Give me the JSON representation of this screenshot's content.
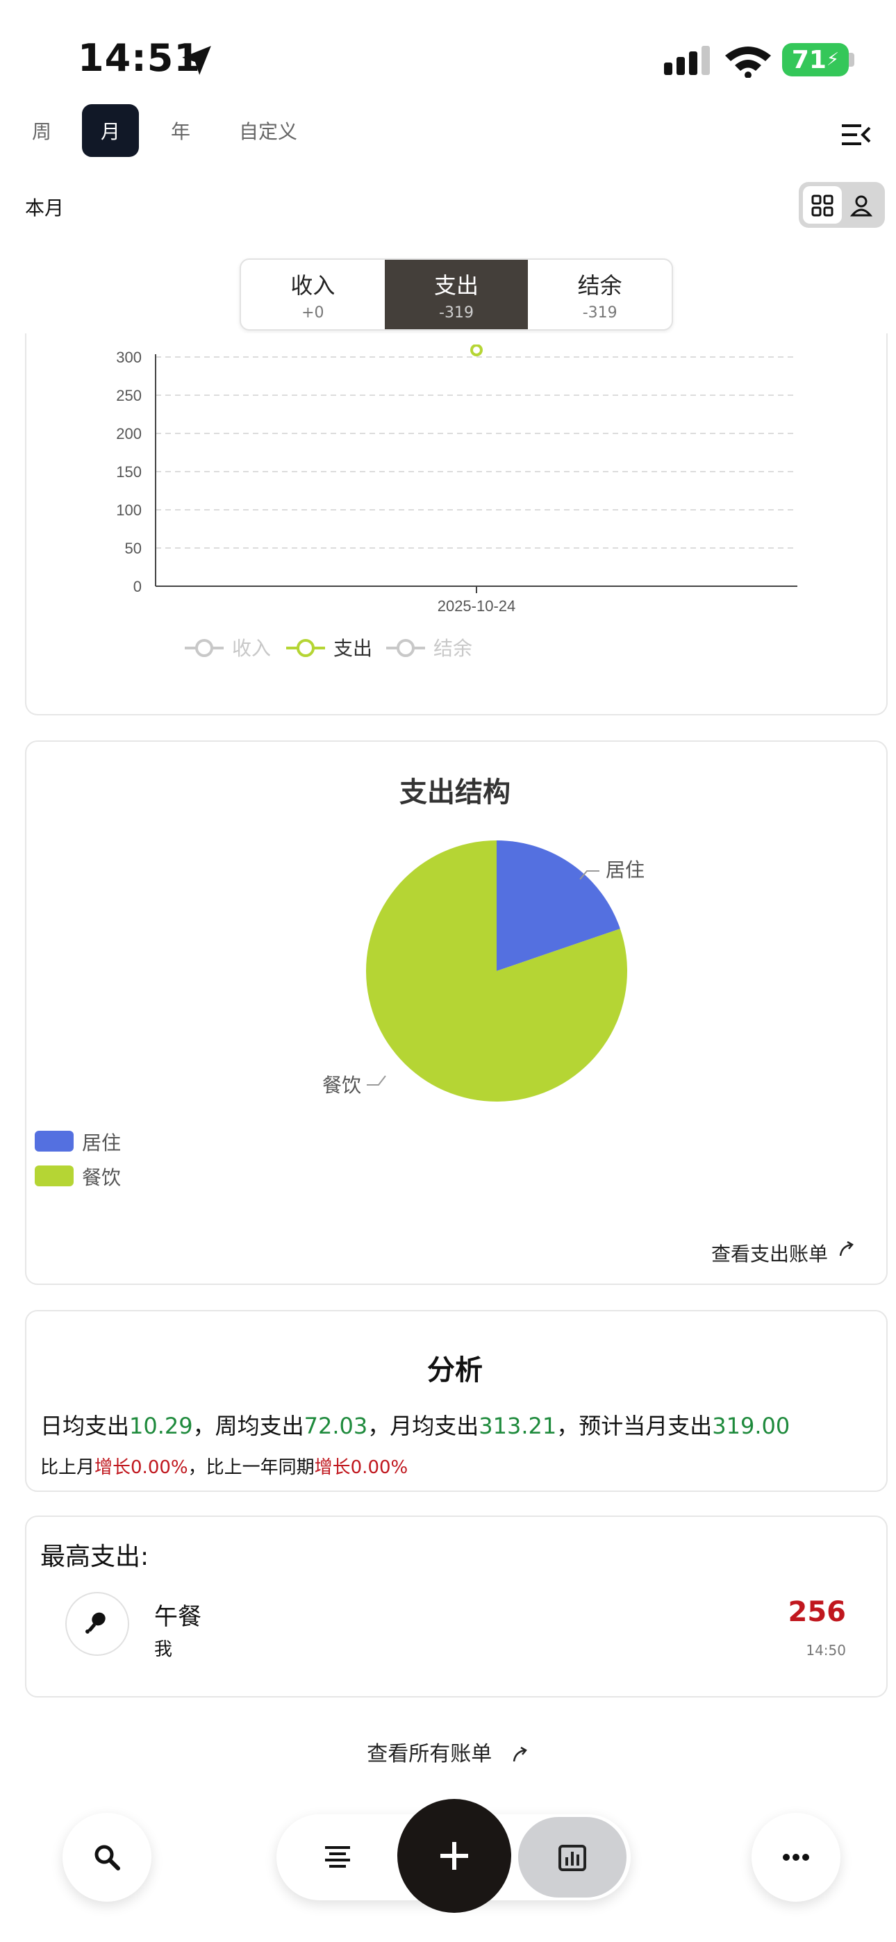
{
  "status_bar": {
    "time": "14:51",
    "battery": "71"
  },
  "period_tabs": [
    {
      "label": "周",
      "active": false
    },
    {
      "label": "月",
      "active": true
    },
    {
      "label": "年",
      "active": false
    },
    {
      "label": "自定义",
      "active": false
    }
  ],
  "range_label": "本月",
  "segments": [
    {
      "label": "收入",
      "value": "+0",
      "active": false
    },
    {
      "label": "支出",
      "value": "-319",
      "active": true
    },
    {
      "label": "结余",
      "value": "-319",
      "active": false
    }
  ],
  "line_chart": {
    "y_ticks": [
      "300",
      "250",
      "200",
      "150",
      "100",
      "50",
      "0"
    ],
    "x_tick": "2025-10-24",
    "legend": [
      {
        "label": "收入",
        "active": false,
        "color": "#c8c8c8"
      },
      {
        "label": "支出",
        "active": true,
        "color": "#b5d534"
      },
      {
        "label": "结余",
        "active": false,
        "color": "#c8c8c8"
      }
    ]
  },
  "chart_data": [
    {
      "type": "line",
      "x": [
        "2025-10-24"
      ],
      "series": [
        {
          "name": "收入",
          "values": [
            0
          ]
        },
        {
          "name": "支出",
          "values": [
            319
          ]
        },
        {
          "name": "结余",
          "values": [
            -319
          ]
        }
      ],
      "ylim": [
        0,
        300
      ],
      "grid": true,
      "legend_position": "bottom"
    },
    {
      "type": "pie",
      "title": "支出结构",
      "labels": [
        "居住",
        "餐饮"
      ],
      "values": [
        63,
        256
      ],
      "colors": [
        "#5470e0",
        "#b5d534"
      ],
      "legend_position": "bottom-left"
    }
  ],
  "pie": {
    "title": "支出结构",
    "labels": [
      "居住",
      "餐饮"
    ],
    "legend": [
      {
        "label": "居住",
        "color": "#5470e0"
      },
      {
        "label": "餐饮",
        "color": "#b5d534"
      }
    ],
    "view_link": "查看支出账单"
  },
  "analysis": {
    "title": "分析",
    "daily_label": "日均支出",
    "daily": "10.29",
    "weekly_label": "，周均支出",
    "weekly": "72.03",
    "monthly_label": "，月均支出",
    "monthly": "313.21",
    "forecast_label": "，预计当月支出",
    "forecast": "319.00",
    "mom_label": "比上月",
    "mom": "增长0.00%",
    "yoy_label": "，比上一年同期",
    "yoy": "增长0.00%"
  },
  "top_expense": {
    "header": "最高支出:",
    "name": "午餐",
    "who": "我",
    "amount": "256",
    "time": "14:50",
    "icon": "drumstick-icon"
  },
  "all_bills_link": "查看所有账单",
  "bottom_nav": {
    "icons": [
      "search-icon",
      "list-icon",
      "add-icon",
      "chart-icon",
      "more-icon"
    ]
  }
}
